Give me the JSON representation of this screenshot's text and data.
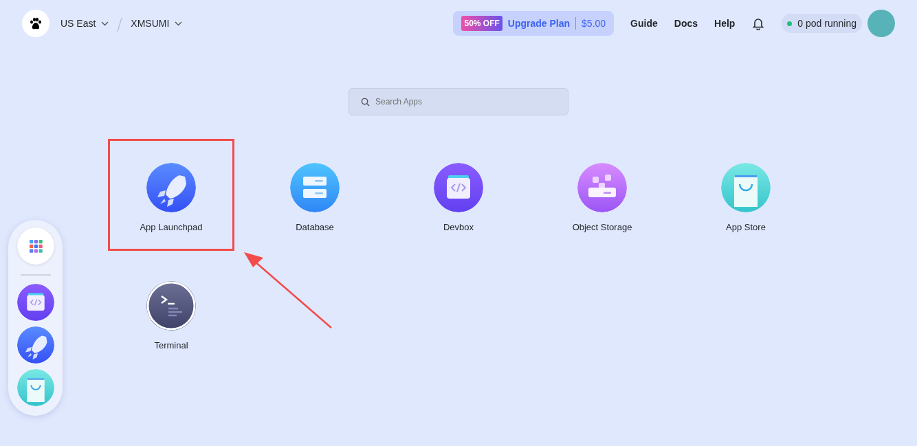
{
  "header": {
    "region": "US East",
    "workspace": "XMSUMI",
    "promo": {
      "badge": "50% OFF",
      "label": "Upgrade Plan",
      "price": "$5.00"
    },
    "links": [
      "Guide",
      "Docs",
      "Help"
    ],
    "pods": {
      "label": "0 pod running",
      "color": "#1fbf7f"
    }
  },
  "search": {
    "placeholder": "Search Apps"
  },
  "apps": [
    {
      "name": "App Launchpad",
      "kind": "rocket",
      "highlighted": true
    },
    {
      "name": "Database",
      "kind": "database",
      "highlighted": false
    },
    {
      "name": "Devbox",
      "kind": "devbox",
      "highlighted": false
    },
    {
      "name": "Object Storage",
      "kind": "storage",
      "highlighted": false
    },
    {
      "name": "App Store",
      "kind": "store",
      "highlighted": false
    },
    {
      "name": "Terminal",
      "kind": "terminal",
      "highlighted": false
    }
  ],
  "dock": [
    {
      "kind": "grid"
    },
    {
      "kind": "devbox"
    },
    {
      "kind": "rocket"
    },
    {
      "kind": "store"
    }
  ]
}
